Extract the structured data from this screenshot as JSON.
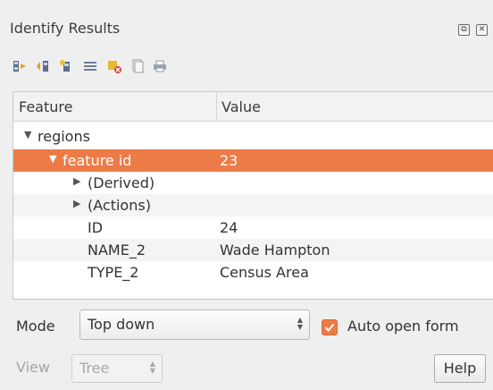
{
  "panel": {
    "title": "Identify Results"
  },
  "window_buttons": {
    "float": "⧉",
    "close": "✕"
  },
  "toolbar": {
    "icons": [
      "expand-tree-icon",
      "collapse-tree-icon",
      "expand-new-icon",
      "properties-icon",
      "clear-results-icon",
      "copy-icon",
      "print-icon"
    ]
  },
  "tree": {
    "columns": [
      "Feature",
      "Value"
    ],
    "rows": [
      {
        "feature": "regions",
        "value": "",
        "arrow": "▼"
      },
      {
        "feature": "feature id",
        "value": "23",
        "arrow": "▼"
      },
      {
        "feature": "(Derived)",
        "value": "",
        "arrow": "▶"
      },
      {
        "feature": "(Actions)",
        "value": "",
        "arrow": "▶"
      },
      {
        "feature": "ID",
        "value": "24",
        "arrow": ""
      },
      {
        "feature": "NAME_2",
        "value": "Wade Hampton",
        "arrow": ""
      },
      {
        "feature": "TYPE_2",
        "value": "Census Area",
        "arrow": ""
      }
    ]
  },
  "mode": {
    "label": "Mode",
    "value": "Top down"
  },
  "auto_open": {
    "label": "Auto open form",
    "checked": true
  },
  "view": {
    "label": "View",
    "value": "Tree"
  },
  "help": {
    "label": "Help"
  },
  "colors": {
    "selection": "#ed7b47",
    "checkbox": "#ed7b47"
  }
}
